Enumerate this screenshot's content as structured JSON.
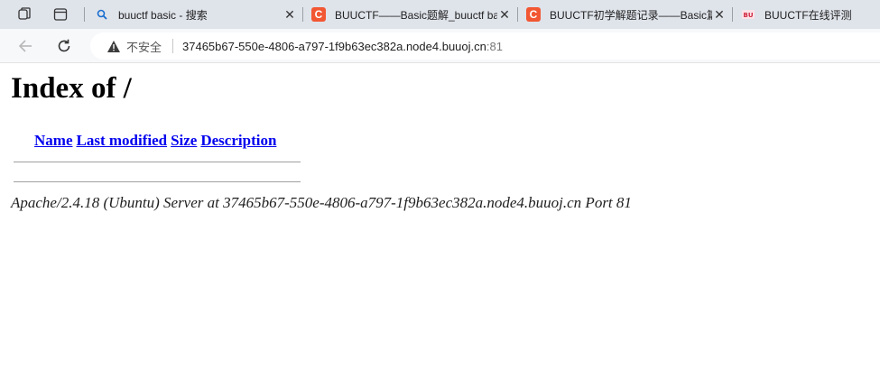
{
  "browser": {
    "tabs": [
      {
        "title": "buuctf basic - 搜索",
        "icon": "search-icon"
      },
      {
        "title": "BUUCTF——Basic题解_buuctf basic",
        "icon": "csdn-icon"
      },
      {
        "title": "BUUCTF初学解题记录——Basic篇_",
        "icon": "csdn-icon"
      },
      {
        "title": "BUUCTF在线评测",
        "icon": "buuctf-icon"
      }
    ],
    "address": {
      "security_label": "不安全",
      "host": "37465b67-550e-4806-a797-1f9b63ec382a.node4.buuoj.cn",
      "port": ":81"
    }
  },
  "page": {
    "heading": "Index of /",
    "columns": [
      "Name",
      "Last modified",
      "Size",
      "Description"
    ],
    "footer": "Apache/2.4.18 (Ubuntu) Server at 37465b67-550e-4806-a797-1f9b63ec382a.node4.buuoj.cn Port 81"
  },
  "colors": {
    "link": "#0000ee",
    "tabstrip": "#dfe3ea",
    "csdn_favicon": "#f25733"
  }
}
